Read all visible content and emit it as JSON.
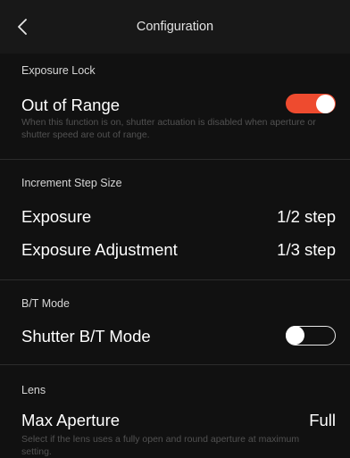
{
  "header": {
    "title": "Configuration"
  },
  "exposure_lock": {
    "section_title": "Exposure Lock",
    "out_of_range": {
      "label": "Out of Range",
      "enabled": true,
      "description": "When this function is on, shutter actuation is disabled when aperture or shutter speed are out of range."
    }
  },
  "increment_step_size": {
    "section_title": "Increment Step Size",
    "exposure": {
      "label": "Exposure",
      "value": "1/2 step"
    },
    "exposure_adjustment": {
      "label": "Exposure Adjustment",
      "value": "1/3 step"
    }
  },
  "bt_mode": {
    "section_title": "B/T Mode",
    "shutter_bt_mode": {
      "label": "Shutter B/T Mode",
      "enabled": false
    }
  },
  "lens": {
    "section_title": "Lens",
    "max_aperture": {
      "label": "Max Aperture",
      "value": "Full",
      "description": "Select if the lens uses a fully open and round aperture at maximum setting."
    }
  },
  "colors": {
    "background": "#111111",
    "toggle_on": "#ee4b2f",
    "description_text": "#525252",
    "divider": "#2c2c2c"
  },
  "icons": {
    "back": "chevron-left-icon"
  }
}
